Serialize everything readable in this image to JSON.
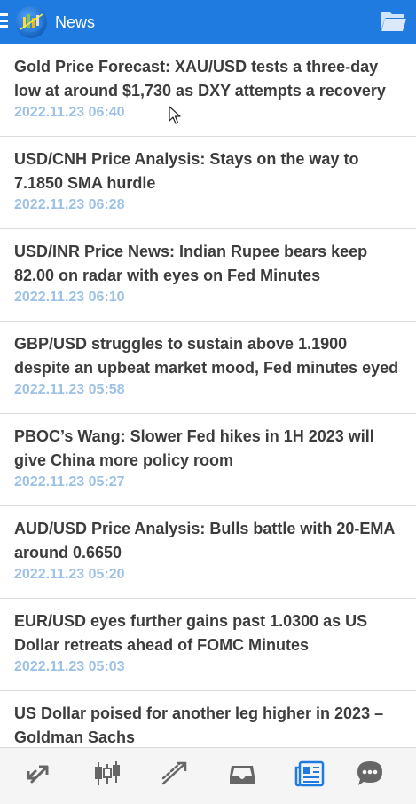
{
  "app": {
    "title": "News",
    "accent_color": "#1f7be0"
  },
  "news": [
    {
      "title": "Gold Price Forecast: XAU/USD tests a three-day low at around $1,730 as DXY attempts a recovery",
      "date": "2022.11.23 06:40"
    },
    {
      "title": "USD/CNH Price Analysis: Stays on the way to 7.1850 SMA hurdle",
      "date": "2022.11.23 06:28"
    },
    {
      "title": "USD/INR Price News: Indian Rupee bears keep 82.00 on radar with eyes on Fed Minutes",
      "date": "2022.11.23 06:10"
    },
    {
      "title": "GBP/USD struggles to sustain above 1.1900 despite an upbeat market mood, Fed minutes eyed",
      "date": "2022.11.23 05:58"
    },
    {
      "title": "PBOC’s Wang: Slower Fed hikes in 1H 2023 will give China more policy room",
      "date": "2022.11.23 05:27"
    },
    {
      "title": "AUD/USD Price Analysis: Bulls battle with 20-EMA around 0.6650",
      "date": "2022.11.23 05:20"
    },
    {
      "title": "EUR/USD eyes further gains past 1.0300 as US Dollar retreats ahead of FOMC Minutes",
      "date": "2022.11.23 05:03"
    },
    {
      "title": "US Dollar poised for another leg higher in 2023 – Goldman Sachs",
      "date": ""
    }
  ],
  "bottom_nav": [
    {
      "icon": "quotes-arrows-icon",
      "active": false
    },
    {
      "icon": "candlestick-chart-icon",
      "active": false
    },
    {
      "icon": "trade-icon",
      "active": false
    },
    {
      "icon": "inbox-icon",
      "active": false
    },
    {
      "icon": "news-icon",
      "active": true
    },
    {
      "icon": "chat-icon",
      "active": false
    }
  ]
}
